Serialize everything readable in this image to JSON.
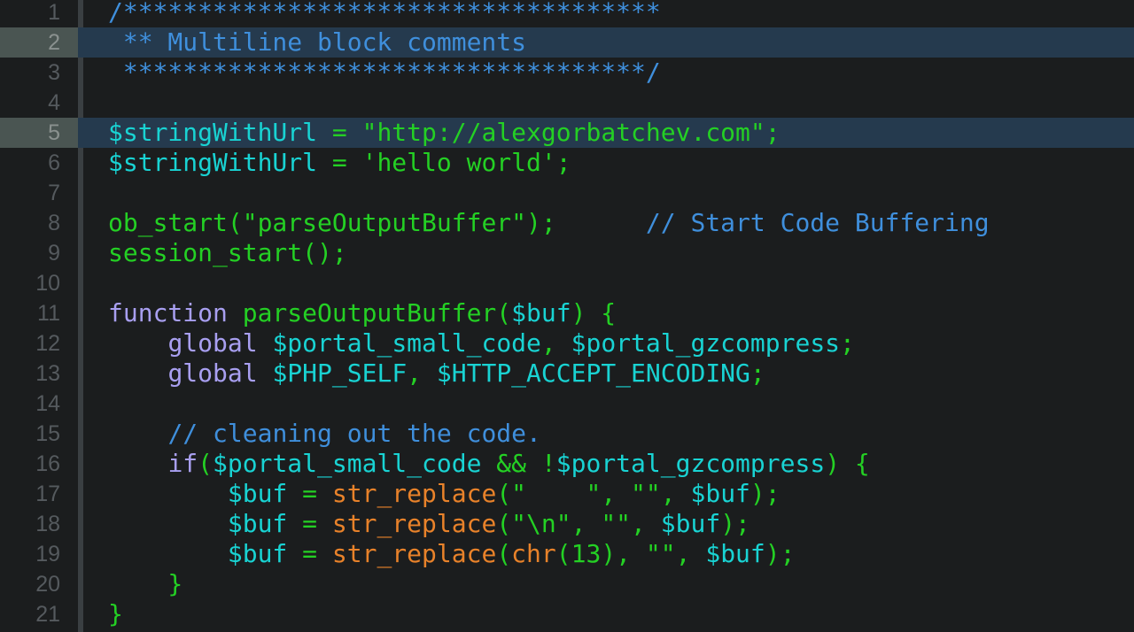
{
  "editor": {
    "highlighted_lines": [
      2,
      5
    ],
    "colors": {
      "background": "#1b1d1e",
      "gutter_rule": "#3a3f42",
      "line_number": "#555a5e",
      "current_line": "#253a4e",
      "comment": "#3f8fdc",
      "variable": "#19d3d3",
      "string": "#24d024",
      "plain": "#24d024",
      "keyword": "#a89ff0",
      "builtin": "#e8822a"
    },
    "lines": [
      {
        "n": "1",
        "tokens": [
          {
            "c": "comment",
            "t": "/************************************"
          }
        ]
      },
      {
        "n": "2",
        "tokens": [
          {
            "c": "comment",
            "t": " ** Multiline block comments"
          }
        ]
      },
      {
        "n": "3",
        "tokens": [
          {
            "c": "comment",
            "t": " ***********************************/"
          }
        ]
      },
      {
        "n": "4",
        "tokens": []
      },
      {
        "n": "5",
        "tokens": [
          {
            "c": "variable",
            "t": "$stringWithUrl"
          },
          {
            "c": "plain",
            "t": " = "
          },
          {
            "c": "string",
            "t": "\"http://alexgorbatchev.com\""
          },
          {
            "c": "plain",
            "t": ";"
          }
        ]
      },
      {
        "n": "6",
        "tokens": [
          {
            "c": "variable",
            "t": "$stringWithUrl"
          },
          {
            "c": "plain",
            "t": " = "
          },
          {
            "c": "string",
            "t": "'hello world'"
          },
          {
            "c": "plain",
            "t": ";"
          }
        ]
      },
      {
        "n": "7",
        "tokens": []
      },
      {
        "n": "8",
        "tokens": [
          {
            "c": "plain",
            "t": "ob_start("
          },
          {
            "c": "string",
            "t": "\"parseOutputBuffer\""
          },
          {
            "c": "plain",
            "t": ");      "
          },
          {
            "c": "comment",
            "t": "// Start Code Buffering"
          }
        ]
      },
      {
        "n": "9",
        "tokens": [
          {
            "c": "plain",
            "t": "session_start();"
          }
        ]
      },
      {
        "n": "10",
        "tokens": []
      },
      {
        "n": "11",
        "tokens": [
          {
            "c": "keyword",
            "t": "function"
          },
          {
            "c": "plain",
            "t": " parseOutputBuffer("
          },
          {
            "c": "variable",
            "t": "$buf"
          },
          {
            "c": "plain",
            "t": ") {"
          }
        ]
      },
      {
        "n": "12",
        "tokens": [
          {
            "c": "plain",
            "t": "    "
          },
          {
            "c": "keyword",
            "t": "global"
          },
          {
            "c": "plain",
            "t": " "
          },
          {
            "c": "variable",
            "t": "$portal_small_code"
          },
          {
            "c": "plain",
            "t": ", "
          },
          {
            "c": "variable",
            "t": "$portal_gzcompress"
          },
          {
            "c": "plain",
            "t": ";"
          }
        ]
      },
      {
        "n": "13",
        "tokens": [
          {
            "c": "plain",
            "t": "    "
          },
          {
            "c": "keyword",
            "t": "global"
          },
          {
            "c": "plain",
            "t": " "
          },
          {
            "c": "variable",
            "t": "$PHP_SELF"
          },
          {
            "c": "plain",
            "t": ", "
          },
          {
            "c": "variable",
            "t": "$HTTP_ACCEPT_ENCODING"
          },
          {
            "c": "plain",
            "t": ";"
          }
        ]
      },
      {
        "n": "14",
        "tokens": []
      },
      {
        "n": "15",
        "tokens": [
          {
            "c": "plain",
            "t": "    "
          },
          {
            "c": "comment",
            "t": "// cleaning out the code."
          }
        ]
      },
      {
        "n": "16",
        "tokens": [
          {
            "c": "plain",
            "t": "    "
          },
          {
            "c": "keyword",
            "t": "if"
          },
          {
            "c": "plain",
            "t": "("
          },
          {
            "c": "variable",
            "t": "$portal_small_code"
          },
          {
            "c": "plain",
            "t": " && !"
          },
          {
            "c": "variable",
            "t": "$portal_gzcompress"
          },
          {
            "c": "plain",
            "t": ") {"
          }
        ]
      },
      {
        "n": "17",
        "tokens": [
          {
            "c": "plain",
            "t": "        "
          },
          {
            "c": "variable",
            "t": "$buf"
          },
          {
            "c": "plain",
            "t": " = "
          },
          {
            "c": "builtin",
            "t": "str_replace"
          },
          {
            "c": "plain",
            "t": "("
          },
          {
            "c": "string",
            "t": "\"    \""
          },
          {
            "c": "plain",
            "t": ", "
          },
          {
            "c": "string",
            "t": "\"\""
          },
          {
            "c": "plain",
            "t": ", "
          },
          {
            "c": "variable",
            "t": "$buf"
          },
          {
            "c": "plain",
            "t": ");"
          }
        ]
      },
      {
        "n": "18",
        "tokens": [
          {
            "c": "plain",
            "t": "        "
          },
          {
            "c": "variable",
            "t": "$buf"
          },
          {
            "c": "plain",
            "t": " = "
          },
          {
            "c": "builtin",
            "t": "str_replace"
          },
          {
            "c": "plain",
            "t": "("
          },
          {
            "c": "string",
            "t": "\"\\n\""
          },
          {
            "c": "plain",
            "t": ", "
          },
          {
            "c": "string",
            "t": "\"\""
          },
          {
            "c": "plain",
            "t": ", "
          },
          {
            "c": "variable",
            "t": "$buf"
          },
          {
            "c": "plain",
            "t": ");"
          }
        ]
      },
      {
        "n": "19",
        "tokens": [
          {
            "c": "plain",
            "t": "        "
          },
          {
            "c": "variable",
            "t": "$buf"
          },
          {
            "c": "plain",
            "t": " = "
          },
          {
            "c": "builtin",
            "t": "str_replace"
          },
          {
            "c": "plain",
            "t": "("
          },
          {
            "c": "builtin",
            "t": "chr"
          },
          {
            "c": "plain",
            "t": "(13), "
          },
          {
            "c": "string",
            "t": "\"\""
          },
          {
            "c": "plain",
            "t": ", "
          },
          {
            "c": "variable",
            "t": "$buf"
          },
          {
            "c": "plain",
            "t": ");"
          }
        ]
      },
      {
        "n": "20",
        "tokens": [
          {
            "c": "plain",
            "t": "    }"
          }
        ]
      },
      {
        "n": "21",
        "tokens": [
          {
            "c": "plain",
            "t": "}"
          }
        ]
      }
    ]
  }
}
